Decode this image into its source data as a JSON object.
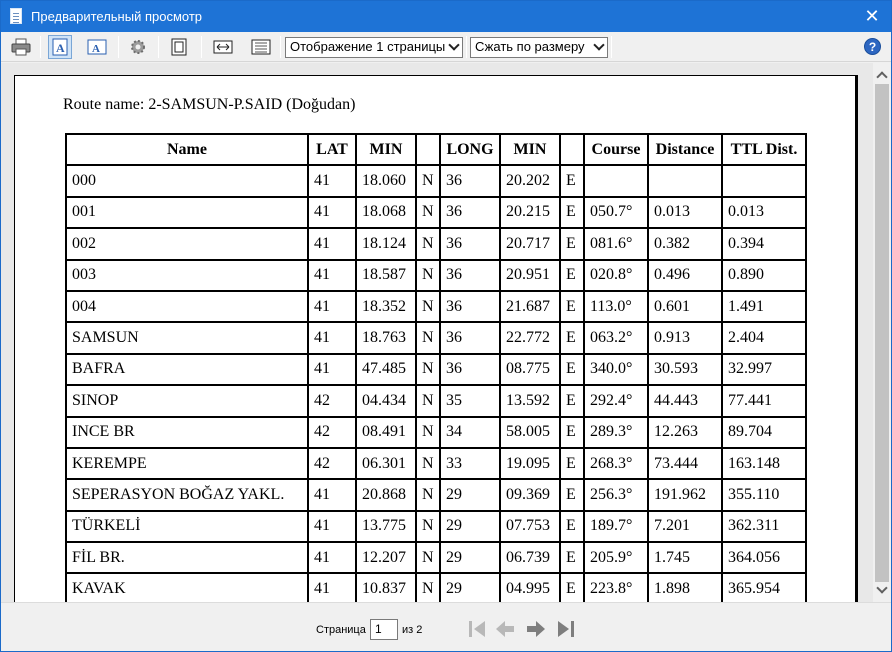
{
  "window": {
    "title": "Предварительный просмотр",
    "close_glyph": "✕"
  },
  "toolbar": {
    "buttons": [
      {
        "name": "print-icon"
      },
      {
        "name": "single-page-icon",
        "pressed": true
      },
      {
        "name": "page-setup-icon"
      },
      {
        "name": "settings-gear-icon"
      },
      {
        "name": "full-page-icon"
      },
      {
        "name": "fit-width-icon"
      },
      {
        "name": "thumbnails-icon"
      }
    ],
    "display_mode": "Отображение 1 страницы",
    "zoom_mode": "Сжать по размеру",
    "help_glyph": "?"
  },
  "document": {
    "route_name": "Route name: 2-SAMSUN-P.SAID (Doğudan)",
    "headers": [
      "Name",
      "LAT",
      "MIN",
      "",
      "LONG",
      "MIN",
      "",
      "Course",
      "Distance",
      "TTL Dist."
    ],
    "rows": [
      [
        "000",
        "41",
        "18.060",
        "N",
        "36",
        "20.202",
        "E",
        "",
        "",
        ""
      ],
      [
        "001",
        "41",
        "18.068",
        "N",
        "36",
        "20.215",
        "E",
        "050.7°",
        "0.013",
        "0.013"
      ],
      [
        "002",
        "41",
        "18.124",
        "N",
        "36",
        "20.717",
        "E",
        "081.6°",
        "0.382",
        "0.394"
      ],
      [
        "003",
        "41",
        "18.587",
        "N",
        "36",
        "20.951",
        "E",
        "020.8°",
        "0.496",
        "0.890"
      ],
      [
        "004",
        "41",
        "18.352",
        "N",
        "36",
        "21.687",
        "E",
        "113.0°",
        "0.601",
        "1.491"
      ],
      [
        "SAMSUN",
        "41",
        "18.763",
        "N",
        "36",
        "22.772",
        "E",
        "063.2°",
        "0.913",
        "2.404"
      ],
      [
        "BAFRA",
        "41",
        "47.485",
        "N",
        "36",
        "08.775",
        "E",
        "340.0°",
        "30.593",
        "32.997"
      ],
      [
        "SINOP",
        "42",
        "04.434",
        "N",
        "35",
        "13.592",
        "E",
        "292.4°",
        "44.443",
        "77.441"
      ],
      [
        "INCE BR",
        "42",
        "08.491",
        "N",
        "34",
        "58.005",
        "E",
        "289.3°",
        "12.263",
        "89.704"
      ],
      [
        "KEREMPE",
        "42",
        "06.301",
        "N",
        "33",
        "19.095",
        "E",
        "268.3°",
        "73.444",
        "163.148"
      ],
      [
        "SEPERASYON BOĞAZ YAKL.",
        "41",
        "20.868",
        "N",
        "29",
        "09.369",
        "E",
        "256.3°",
        "191.962",
        "355.110"
      ],
      [
        "TÜRKELİ",
        "41",
        "13.775",
        "N",
        "29",
        "07.753",
        "E",
        "189.7°",
        "7.201",
        "362.311"
      ],
      [
        "FİL BR.",
        "41",
        "12.207",
        "N",
        "29",
        "06.739",
        "E",
        "205.9°",
        "1.745",
        "364.056"
      ],
      [
        "KAVAK",
        "41",
        "10.837",
        "N",
        "29",
        "04.995",
        "E",
        "223.8°",
        "1.898",
        "365.954"
      ]
    ]
  },
  "statusbar": {
    "page_label": "Страница",
    "current_page": "1",
    "of_label": "из 2"
  }
}
